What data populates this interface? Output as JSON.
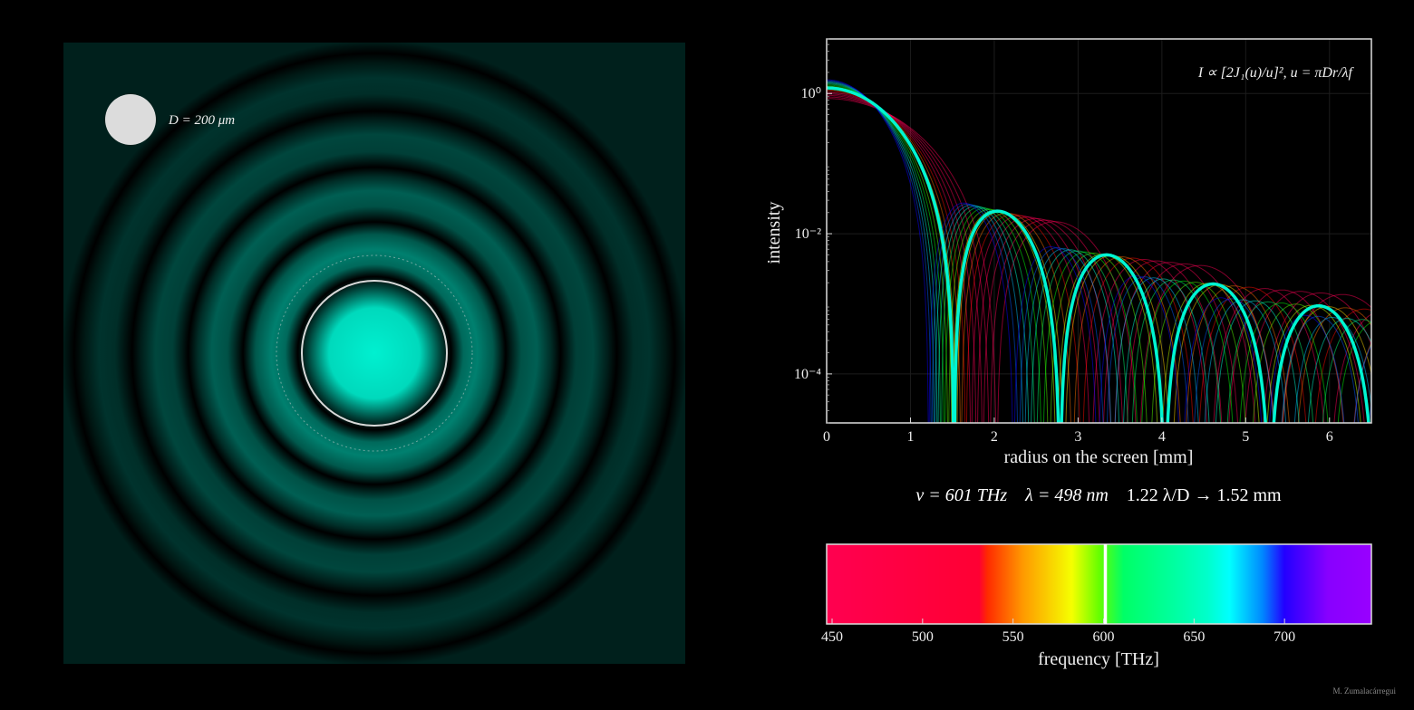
{
  "colors": {
    "background": "#000000",
    "selected_curve": "#00f5d2",
    "axes": "#dddddd"
  },
  "left_panel": {
    "aperture_label": "D = 200 μm",
    "aperture_diameter_um": 200
  },
  "readout": {
    "nu_label": "ν = 601 THz",
    "lambda_label": "λ = 498 nm",
    "airy_label": "1.22 λ/D → 1.52 mm"
  },
  "credit": "M. Zumalacárregui",
  "chart_data": [
    {
      "type": "line",
      "title": "",
      "annotation": "I ∝ [2J₁(u)/u]², u = πDr/λf",
      "xlabel": "radius on the screen [mm]",
      "ylabel": "intensity",
      "xlim": [
        0,
        6.5
      ],
      "ylim": [
        2e-05,
        6
      ],
      "yscale": "log",
      "grid": true,
      "x_ticks": [
        0,
        1,
        2,
        3,
        4,
        5,
        6
      ],
      "x_tick_labels": [
        "0",
        "1",
        "2",
        "3",
        "4",
        "5",
        "6"
      ],
      "y_ticks": [
        1,
        0.01,
        0.0001
      ],
      "y_tick_labels": [
        "10⁰",
        "10⁻²",
        "10⁻⁴"
      ],
      "selected_series": {
        "frequency_THz": 601,
        "first_zero_mm": 1.52,
        "x": [
          0,
          0.3,
          0.6,
          0.9,
          1.2,
          1.4,
          1.52,
          1.7,
          2.03,
          2.4,
          2.78,
          3.0,
          3.33,
          3.7,
          4.03,
          4.3,
          4.6,
          5.0,
          5.28,
          5.6,
          5.9,
          6.3,
          6.5
        ],
        "y": [
          1.2,
          0.95,
          0.5,
          0.17,
          0.018,
          0.0012,
          0,
          0.0065,
          0.022,
          0.01,
          0,
          0.0018,
          0.0052,
          0.0022,
          0,
          0.0008,
          0.0019,
          0.0006,
          0,
          0.0004,
          0.00095,
          0.0004,
          5e-05
        ]
      },
      "background_series_frequencies_THz": [
        450,
        470,
        490,
        510,
        530,
        550,
        570,
        590,
        610,
        630,
        650,
        670,
        690,
        710,
        730,
        750
      ]
    },
    {
      "type": "heatmap",
      "xlabel": "frequency [THz]",
      "xlim": [
        447,
        748
      ],
      "x_ticks": [
        450,
        500,
        550,
        600,
        650,
        700
      ],
      "x_tick_labels": [
        "450",
        "500",
        "550",
        "600",
        "650",
        "700"
      ],
      "selected_value": 601
    }
  ]
}
